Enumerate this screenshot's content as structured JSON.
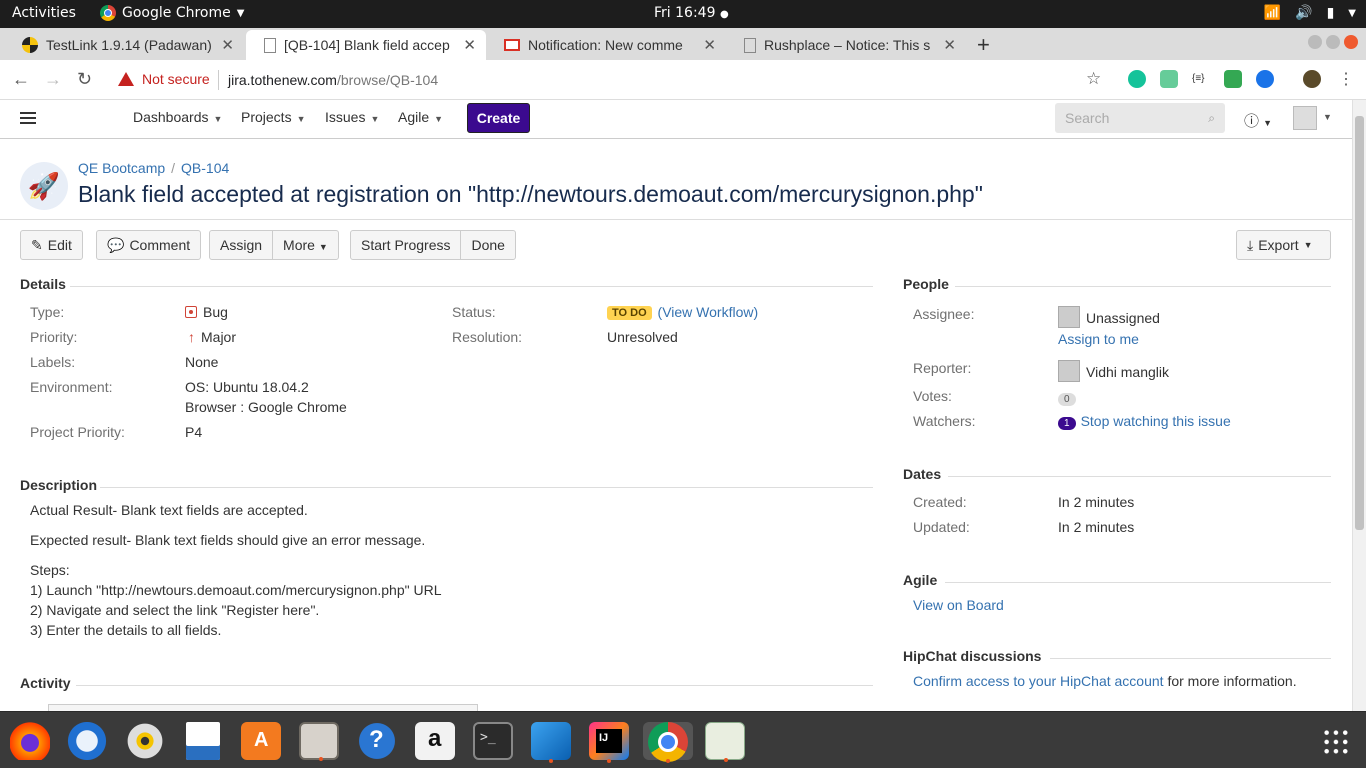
{
  "ubuntu": {
    "activities": "Activities",
    "app_name": "Google Chrome",
    "clock": "Fri 16:49"
  },
  "tabs": [
    {
      "title": "TestLink 1.9.14 (Padawan)",
      "icon": "testlink-icon"
    },
    {
      "title": "[QB-104] Blank field accep",
      "icon": "page-icon"
    },
    {
      "title": "Notification: New comme",
      "icon": "gmail-icon"
    },
    {
      "title": "Rushplace – Notice: This s",
      "icon": "page-icon"
    }
  ],
  "address": {
    "security": "Not secure",
    "host": "jira.tothenew.com",
    "path": "/browse/QB-104"
  },
  "jira": {
    "nav": [
      "Dashboards",
      "Projects",
      "Issues",
      "Agile"
    ],
    "create": "Create",
    "search_placeholder": "Search",
    "breadcrumb_project": "QE Bootcamp",
    "breadcrumb_issue": "QB-104",
    "summary": "Blank field accepted at registration on \"http://newtours.demoaut.com/mercurysignon.php\"",
    "toolbar": {
      "edit": "Edit",
      "comment": "Comment",
      "assign": "Assign",
      "more": "More",
      "start_progress": "Start Progress",
      "done": "Done",
      "export": "Export"
    },
    "details": {
      "heading": "Details",
      "type_label": "Type:",
      "type_value": "Bug",
      "priority_label": "Priority:",
      "priority_value": "Major",
      "labels_label": "Labels:",
      "labels_value": "None",
      "environment_label": "Environment:",
      "environment_line1": "OS: Ubuntu 18.04.2",
      "environment_line2": "Browser : Google Chrome",
      "project_priority_label": "Project Priority:",
      "project_priority_value": "P4",
      "status_label": "Status:",
      "status_value": "TO DO",
      "view_workflow": "View Workflow",
      "resolution_label": "Resolution:",
      "resolution_value": "Unresolved"
    },
    "description": {
      "heading": "Description",
      "line1": "Actual Result- Blank text fields are accepted.",
      "line2": "Expected result- Blank text fields should give an error message.",
      "steps_title": "Steps:",
      "step1": "1) Launch \"http://newtours.demoaut.com/mercurysignon.php\" URL",
      "step2": "2) Navigate and select the link \"Register here\".",
      "step3": "3) Enter the details to all fields."
    },
    "activity_heading": "Activity",
    "people": {
      "heading": "People",
      "assignee_label": "Assignee:",
      "assignee_value": "Unassigned",
      "assign_to_me": "Assign to me",
      "reporter_label": "Reporter:",
      "reporter_value": "Vidhi manglik",
      "votes_label": "Votes:",
      "votes_value": "0",
      "watchers_label": "Watchers:",
      "watchers_count": "1",
      "stop_watching": "Stop watching this issue"
    },
    "dates": {
      "heading": "Dates",
      "created_label": "Created:",
      "created_value": "In 2 minutes",
      "updated_label": "Updated:",
      "updated_value": "In 2 minutes"
    },
    "agile": {
      "heading": "Agile",
      "view_on_board": "View on Board"
    },
    "hipchat": {
      "heading": "HipChat discussions",
      "confirm_link": "Confirm access to your HipChat account",
      "suffix": " for more information."
    }
  },
  "dock": [
    "firefox-icon",
    "thunderbird-icon",
    "rhythmbox-icon",
    "libreoffice-writer-icon",
    "ubuntu-software-icon",
    "files-icon",
    "help-icon",
    "amazon-icon",
    "terminal-icon",
    "vscode-icon",
    "intellij-icon",
    "chrome-icon",
    "system-monitor-icon"
  ]
}
